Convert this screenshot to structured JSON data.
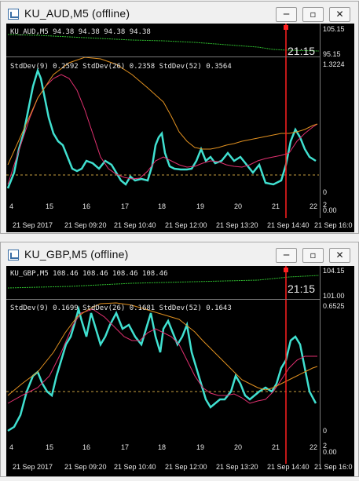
{
  "windows": [
    {
      "title": "KU_AUD,M5 (offline)",
      "price_label": "KU_AUD,M5  94.38 94.38 94.38 94.38",
      "price_scale_top": "105.15",
      "price_scale_bottom": "95.15",
      "clock": "21:15",
      "indicator_label": "StdDev(9) 0.2592  StdDev(26) 0.2358  StdDev(52) 0.3564",
      "indicator_scale_top": "1.3224",
      "indicator_scale_zero": "0",
      "day_labels": [
        "4",
        "15",
        "16",
        "17",
        "18",
        "19",
        "20",
        "21",
        "22"
      ],
      "right_small_top": "2",
      "right_small_bottom": "0.00",
      "time_labels": [
        "21 Sep 2017",
        "21 Sep 09:20",
        "21 Sep 10:40",
        "21 Sep 12:00",
        "21 Sep 13:20",
        "21 Sep 14:40",
        "21 Sep 16:0"
      ]
    },
    {
      "title": "KU_GBP,M5 (offline)",
      "price_label": "KU_GBP,M5  108.46 108.46 108.46 108.46",
      "price_scale_top": "104.15",
      "price_scale_bottom": "101.00",
      "clock": "21:15",
      "indicator_label": "StdDev(9) 0.1699  StdDev(26) 0.1681  StdDev(52) 0.1643",
      "indicator_scale_top": "0.6525",
      "indicator_scale_zero": "0",
      "day_labels": [
        "4",
        "15",
        "16",
        "17",
        "18",
        "19",
        "20",
        "21",
        "22"
      ],
      "right_small_top": "2",
      "right_small_bottom": "0.00",
      "time_labels": [
        "21 Sep 2017",
        "21 Sep 09:20",
        "21 Sep 10:40",
        "21 Sep 12:00",
        "21 Sep 13:20",
        "21 Sep 14:40",
        "21 Sep 16:0"
      ]
    }
  ],
  "buttons": {
    "minimize": "─",
    "restore": "▫",
    "close": "✕"
  },
  "colors": {
    "cyan": "#40e0d0",
    "magenta": "#e0306f",
    "orange": "#e09020",
    "green": "#2fbf2f",
    "red": "#ff2020",
    "grid": "#c8a040"
  },
  "icons": {
    "app": "chart-window-icon"
  }
}
